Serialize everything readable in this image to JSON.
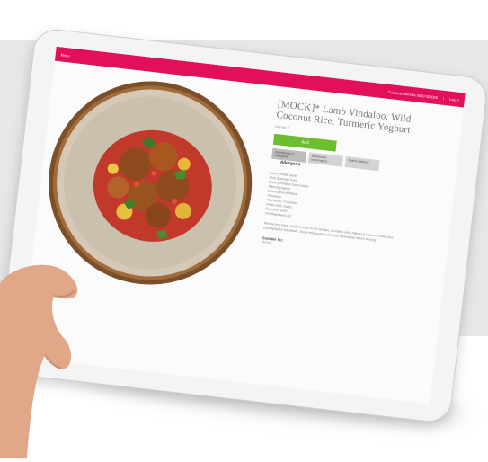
{
  "colors": {
    "brand": "#e2105a",
    "add_button": "#6cbe2e",
    "wall": "#e7e7e7"
  },
  "topbar": {
    "left_text": "Menu",
    "right_link": "Customer service 0800 000000",
    "separator": "|",
    "account_link": "Log in"
  },
  "recipe": {
    "title": "[MOCK]* Lamb Vindaloo, Wild Coconut Rice, Turmeric Yoghurt",
    "meta": "Serves 2",
    "add_label": "Add",
    "tabs": [
      {
        "label": "Ingredients & Allergens"
      },
      {
        "label": "Nutritional Information"
      },
      {
        "label": "Chef's Method"
      }
    ],
    "tab_heading": "Allergens",
    "ingredients": [
      "Lamb (British lamb)",
      "Rice (Basmati rice)",
      "Spice (vindaloo curry paste)",
      "Natural yoghurt",
      "Dried coconut flakes",
      "Tomatoes",
      "Red onion, Coriander",
      "Fresh chilli, Garlic",
      "Turmeric, Lime",
      "Oil (Rapeseed oil)"
    ],
    "description": "Recipe box meal, ready to cook in 30 minutes. Contains milk. Allergens shown in bold. See packaging for full details. Store refrigerated and cook thoroughly before serving.",
    "suitable_label": "Suitable for:",
    "suitable_value": "Home"
  },
  "icons": {
    "plate": "plate-image",
    "hand": "hand-image"
  }
}
